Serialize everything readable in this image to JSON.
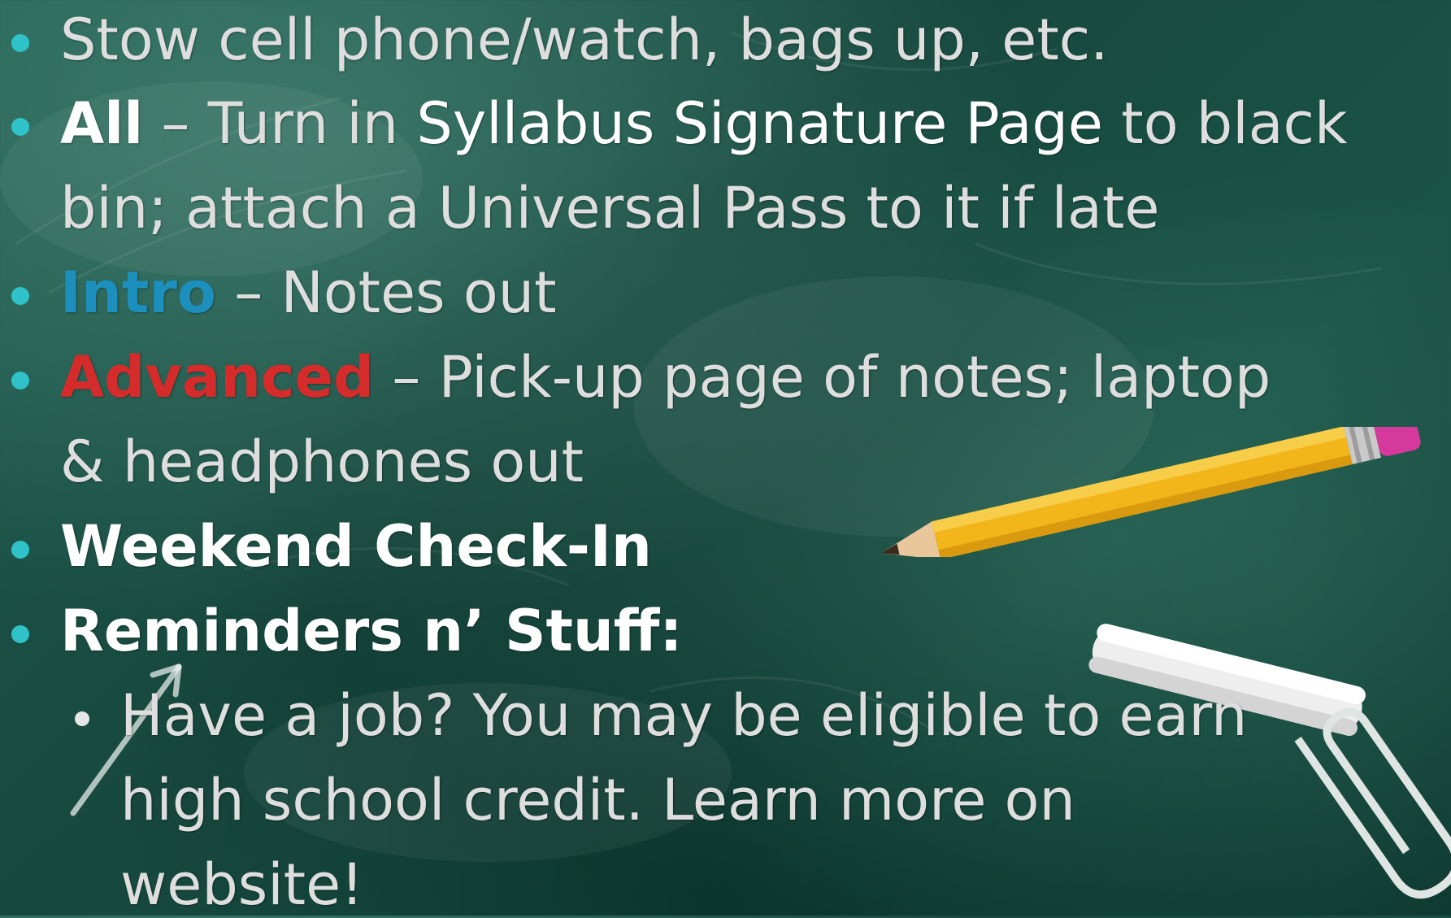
{
  "slide": {
    "lines": {
      "l1": "Stow cell phone/watch, bags up, etc.",
      "l2_label": "All",
      "l2_dash": " – Turn in ",
      "l2_highlight": "Syllabus Signature Page",
      "l2_rest": " to black",
      "l3": "bin; attach a Universal Pass to it if late",
      "l4_label": "Intro",
      "l4_rest": " – Notes out",
      "l5_label": "Advanced",
      "l5_rest": " – Pick-up page of notes; laptop",
      "l6": "& headphones out",
      "l7": "Weekend Check-In",
      "l8": "Reminders n’ Stuff:",
      "sub1": "Have a job?  You may be eligible to earn",
      "sub2": "high school credit.  Learn more on",
      "sub3": "website!"
    }
  },
  "colors": {
    "bullet": "#2fc3c9",
    "intro": "#1d8fbd",
    "advanced": "#d62b2b",
    "text": "#dedede",
    "board": "#1a5447"
  },
  "icons": [
    "pencil-icon",
    "chalk-icon",
    "paperclip-icon",
    "arrow-icon"
  ]
}
